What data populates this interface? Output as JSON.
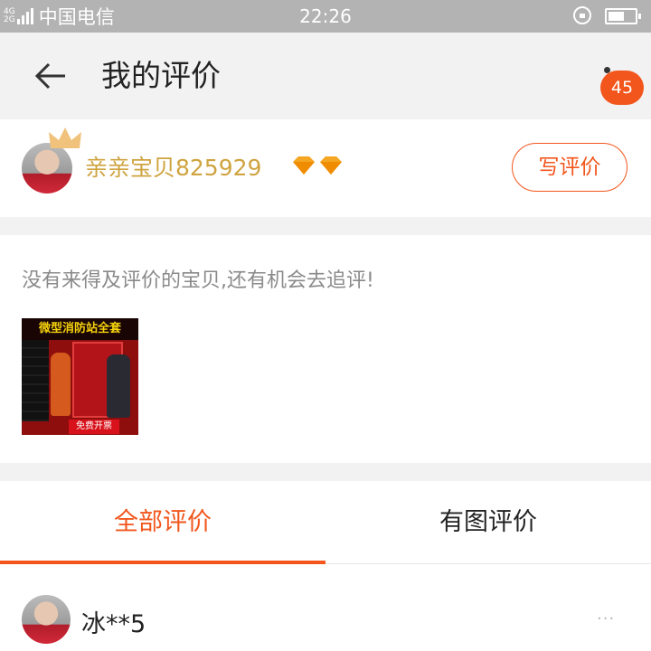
{
  "status_bar": {
    "network_top": "4G",
    "network_bottom": "2G",
    "carrier": "中国电信",
    "time": "22:26",
    "battery_level_percent": 60
  },
  "nav": {
    "title": "我的评价",
    "badge_count": "45"
  },
  "profile": {
    "username": "亲亲宝贝825929",
    "diamond_count": 2,
    "write_button": "写评价"
  },
  "pending": {
    "message": "没有来得及评价的宝贝,还有机会去追评!",
    "product": {
      "banner_text": "微型消防站全套",
      "footer_text": "免费开票"
    }
  },
  "tabs": [
    {
      "label": "全部评价",
      "active": true
    },
    {
      "label": "有图评价",
      "active": false
    }
  ],
  "review": {
    "reviewer_name": "冰**5",
    "more_label": "···"
  },
  "colors": {
    "accent": "#f2561d",
    "gold": "#cfa441",
    "status_bar": "#b3b3b3"
  }
}
